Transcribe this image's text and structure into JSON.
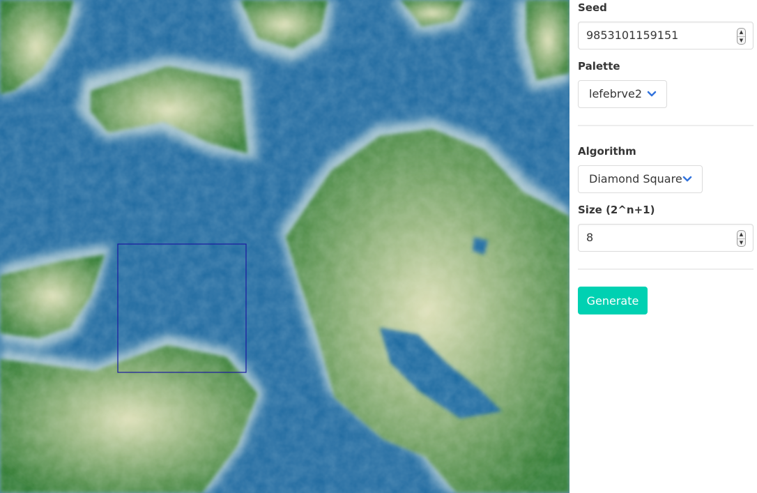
{
  "controls": {
    "seed": {
      "label": "Seed",
      "value": "9853101159151"
    },
    "palette": {
      "label": "Palette",
      "value": "lefebrve2"
    },
    "algorithm": {
      "label": "Algorithm",
      "value": "Diamond Square"
    },
    "size": {
      "label": "Size (2^n+1)",
      "value": "8"
    },
    "generate_label": "Generate"
  },
  "map": {
    "palette_colors": {
      "deep_water": "#1a5f99",
      "shallow_water": "#a9c8d3",
      "lowland": "#2e7d32",
      "highland": "#d9dcb0"
    },
    "selection_color": "#1a1aa0"
  },
  "theme": {
    "accent": "#00d1b2",
    "chevron": "#3273dc"
  }
}
